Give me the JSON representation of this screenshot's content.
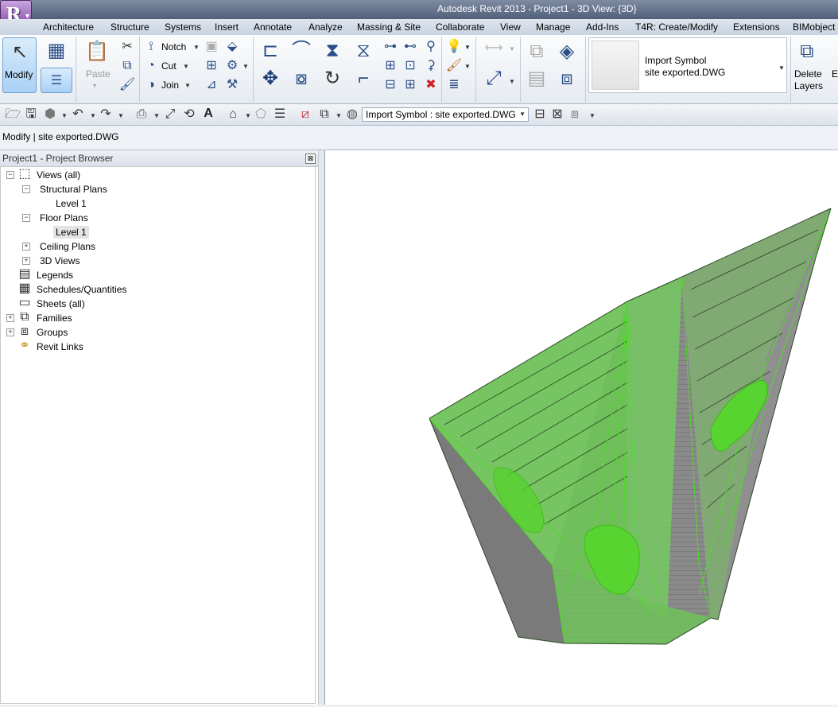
{
  "window": {
    "title": "Autodesk Revit 2013 -    Project1 - 3D View: {3D}"
  },
  "app_button": {
    "glyph": "R"
  },
  "tabs": [
    "Architecture",
    "Structure",
    "Systems",
    "Insert",
    "Annotate",
    "Analyze",
    "Massing & Site",
    "Collaborate",
    "View",
    "Manage",
    "Add-Ins",
    "T4R: Create/Modify",
    "Extensions",
    "BIMobject"
  ],
  "ribbon": {
    "modify_label": "Modify",
    "paste_label": "Paste",
    "notch_label": "Notch",
    "cut_label": "Cut",
    "join_label": "Join",
    "type_selector": {
      "line1": "Import Symbol",
      "line2": "site exported.DWG"
    },
    "delete_layers": {
      "line1": "Delete",
      "line2": "Layers"
    },
    "extra_letter": "E"
  },
  "qat": {
    "selector_value": "Import Symbol : site exported.DWG"
  },
  "options_bar": {
    "text": "Modify | site exported.DWG"
  },
  "project_browser": {
    "title": "Project1 - Project Browser",
    "close_glyph": "⊠",
    "items": [
      {
        "label": "Views (all)",
        "toggle": "−"
      },
      {
        "label": "Structural Plans",
        "toggle": "−"
      },
      {
        "label": "Level 1"
      },
      {
        "label": "Floor Plans",
        "toggle": "−"
      },
      {
        "label": "Level 1"
      },
      {
        "label": "Ceiling Plans",
        "toggle": "+"
      },
      {
        "label": "3D Views",
        "toggle": "+"
      },
      {
        "label": "Legends"
      },
      {
        "label": "Schedules/Quantities"
      },
      {
        "label": "Sheets (all)"
      },
      {
        "label": "Families",
        "toggle": "+"
      },
      {
        "label": "Groups",
        "toggle": "+"
      },
      {
        "label": "Revit Links"
      }
    ]
  },
  "colors": {
    "accent": "#6fc15a",
    "mesh": "#4fdb2a",
    "terrain_dark": "#7a7a7a",
    "selection": "#a9d0f5"
  }
}
